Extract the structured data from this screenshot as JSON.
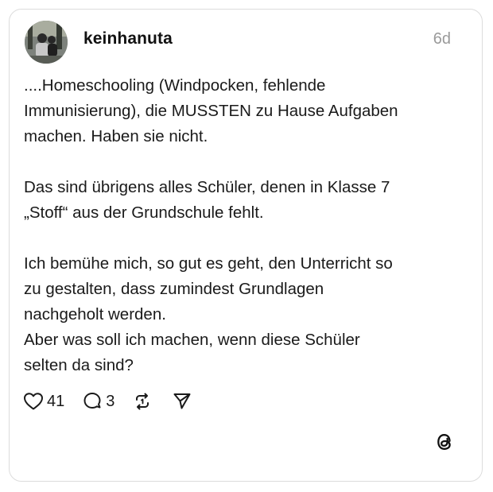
{
  "post": {
    "username": "keinhanuta",
    "timestamp": "6d",
    "paragraphs": [
      {
        "lines": [
          "....Homeschooling (Windpocken, fehlende",
          "Immunisierung), die MUSSTEN zu Hause Aufgaben",
          "machen. Haben sie nicht."
        ]
      },
      {
        "lines": [
          "Das sind übrigens alles Schüler, denen in Klasse 7",
          "„Stoff“ aus der Grundschule fehlt."
        ]
      },
      {
        "lines": [
          "Ich bemühe mich, so gut es geht, den Unterricht so",
          "zu gestalten, dass zumindest Grundlagen",
          "nachgeholt werden.",
          "Aber was soll ich machen, wenn diese Schüler",
          "selten da sind?"
        ]
      }
    ]
  },
  "actions": {
    "likes": "41",
    "replies": "3"
  },
  "icons": {
    "like": "heart-icon",
    "reply": "comment-icon",
    "repost": "repost-icon",
    "share": "send-icon",
    "brand": "threads-logo-icon"
  },
  "colors": {
    "text": "#1a1a1a",
    "muted": "#9a9a9a",
    "border": "#dcdcdc"
  }
}
